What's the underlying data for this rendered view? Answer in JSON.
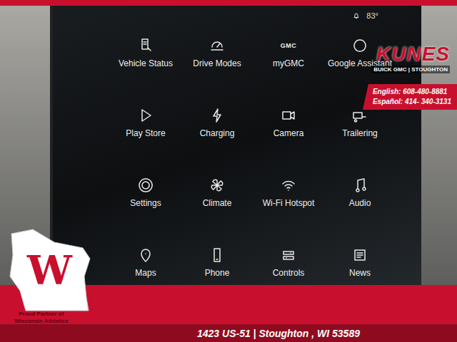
{
  "status_bar": {
    "temperature": "83°"
  },
  "apps": [
    {
      "label": "Vehicle Status"
    },
    {
      "label": "Drive Modes"
    },
    {
      "label": "myGMC",
      "icon_text": "GMC"
    },
    {
      "label": "Google Assistant"
    },
    {
      "label": "Play Store"
    },
    {
      "label": "Charging"
    },
    {
      "label": "Camera"
    },
    {
      "label": "Trailering"
    },
    {
      "label": "Settings"
    },
    {
      "label": "Climate"
    },
    {
      "label": "Wi-Fi Hotspot"
    },
    {
      "label": "Audio"
    },
    {
      "label": "Maps"
    },
    {
      "label": "Phone"
    },
    {
      "label": "Controls"
    },
    {
      "label": "News"
    }
  ],
  "dealer": {
    "logo": "KUNES",
    "subtitle": "BUICK GMC | STOUGHTON",
    "phones": [
      "English: 608-480-8881",
      "Español: 414- 340-3131"
    ]
  },
  "badge": {
    "letter": "W",
    "lines": [
      "Proud Partner of",
      "Wisconsin Athletics"
    ]
  },
  "address": "1423 US-51 | Stoughton , WI 53589"
}
